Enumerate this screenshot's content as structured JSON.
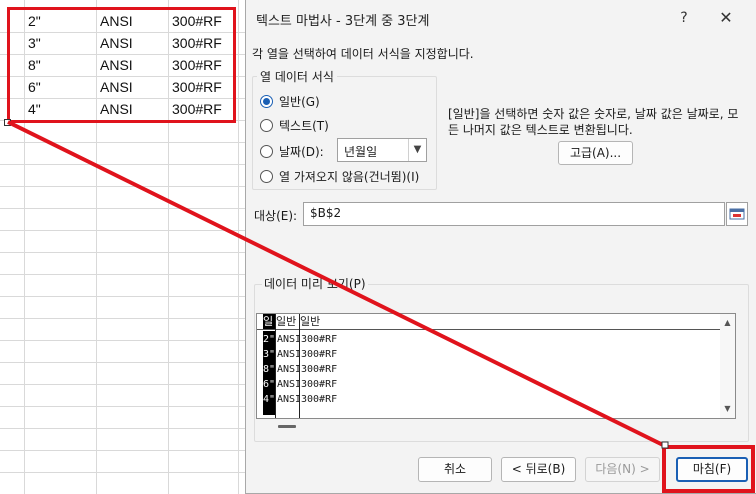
{
  "sheet": {
    "rows": [
      {
        "col_a": "2\"",
        "col_b": "ANSI",
        "col_c": "300#RF"
      },
      {
        "col_a": "3\"",
        "col_b": "ANSI",
        "col_c": "300#RF"
      },
      {
        "col_a": "8\"",
        "col_b": "ANSI",
        "col_c": "300#RF"
      },
      {
        "col_a": "6\"",
        "col_b": "ANSI",
        "col_c": "300#RF"
      },
      {
        "col_a": "4\"",
        "col_b": "ANSI",
        "col_c": "300#RF"
      }
    ]
  },
  "dialog": {
    "title": "텍스트 마법사 - 3단계 중 3단계",
    "help": "?",
    "close": "✕",
    "instruction": "각 열을 선택하여 데이터 서식을 지정합니다.",
    "format_group": {
      "legend": "열 데이터 서식",
      "options": [
        {
          "label": "일반(G)",
          "checked": true
        },
        {
          "label": "텍스트(T)",
          "checked": false
        },
        {
          "label": "날짜(D):",
          "checked": false
        },
        {
          "label": "열 가져오지 않음(건너뜀)(I)",
          "checked": false
        }
      ],
      "date_format": "년월일"
    },
    "description": "[일반]을 선택하면 숫자 값은 숫자로, 날짜 값은 날짜로, 모든 나머지 값은 텍스트로 변환됩니다.",
    "advanced_button": "고급(A)...",
    "destination_label": "대상(E):",
    "destination_value": "$B$2",
    "preview": {
      "legend": "데이터 미리 보기(P)",
      "headers": [
        "일",
        "일반",
        "일반"
      ],
      "rows": [
        [
          "2\"",
          "ANSI",
          "300#RF"
        ],
        [
          "3\"",
          "ANSI",
          "300#RF"
        ],
        [
          "8\"",
          "ANSI",
          "300#RF"
        ],
        [
          "6\"",
          "ANSI",
          "300#RF"
        ],
        [
          "4\"",
          "ANSI",
          "300#RF"
        ]
      ]
    },
    "buttons": {
      "cancel": "취소",
      "back": "< 뒤로(B)",
      "next": "다음(N) >",
      "finish": "마침(F)"
    }
  },
  "colors": {
    "highlight": "#e0131c",
    "accent": "#1a5fb4"
  }
}
